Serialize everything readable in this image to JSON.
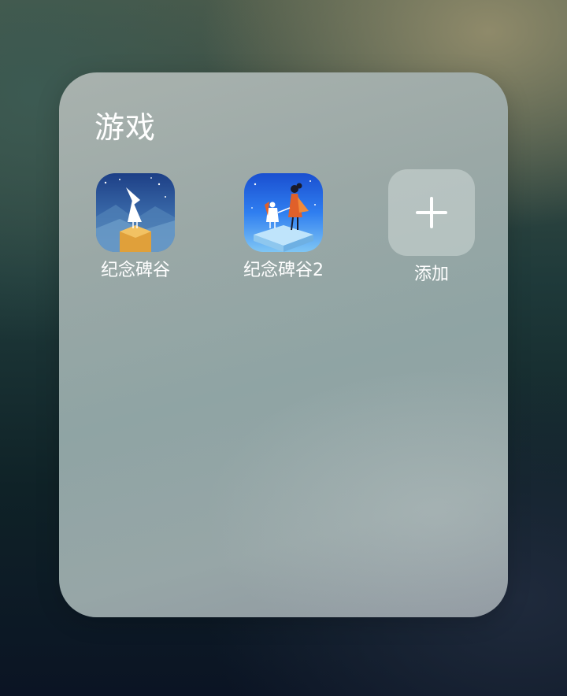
{
  "folder": {
    "title": "游戏"
  },
  "apps": [
    {
      "label": "纪念碑谷",
      "icon": "monument-valley-icon"
    },
    {
      "label": "纪念碑谷2",
      "icon": "monument-valley-2-icon"
    }
  ],
  "add": {
    "label": "添加",
    "icon": "plus-icon"
  },
  "colors": {
    "folder_bg": "#9aa8a6",
    "label_text": "#ffffff"
  }
}
